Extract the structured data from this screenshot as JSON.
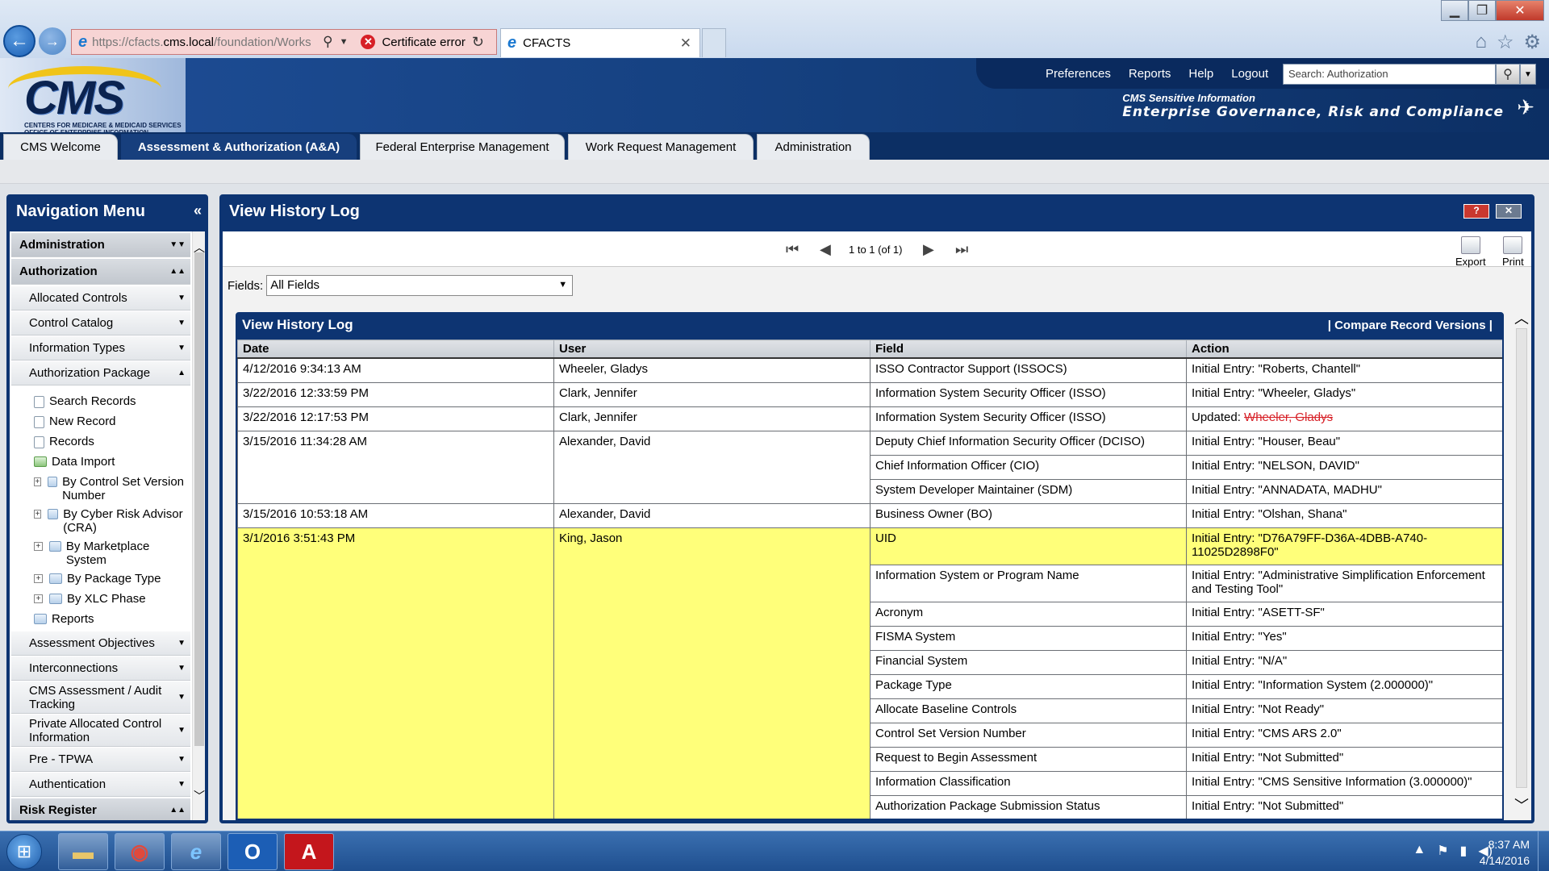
{
  "browser": {
    "url_prefix": "https://cfacts.",
    "url_host": "cms.local",
    "url_path": "/foundation/Works",
    "certificate_error": "Certificate error",
    "tab_title": "CFACTS"
  },
  "header": {
    "logo_text": "CMS",
    "logo_subtext": "CENTERS FOR MEDICARE & MEDICAID SERVICES OFFICE OF ENTERPRISE INFORMATION",
    "links": [
      "Preferences",
      "Reports",
      "Help",
      "Logout"
    ],
    "search_value": "Search: Authorization",
    "tagline_1": "CMS Sensitive Information",
    "tagline_2": "Enterprise Governance, Risk and Compliance"
  },
  "module_tabs": [
    "CMS Welcome",
    "Assessment & Authorization (A&A)",
    "Federal Enterprise Management",
    "Work Request Management",
    "Administration"
  ],
  "nav": {
    "title": "Navigation Menu",
    "administration": "Administration",
    "authorization": "Authorization",
    "allocated_controls": "Allocated Controls",
    "control_catalog": "Control Catalog",
    "information_types": "Information Types",
    "authorization_package": "Authorization Package",
    "search_records": "Search Records",
    "new_record": "New Record",
    "records": "Records",
    "data_import": "Data Import",
    "by_control_set": "By Control Set Version Number",
    "by_cyber_risk": "By Cyber Risk Advisor (CRA)",
    "by_marketplace": "By Marketplace System",
    "by_package_type": "By Package Type",
    "by_xlc_phase": "By XLC Phase",
    "reports": "Reports",
    "assessment_objectives": "Assessment Objectives",
    "interconnections": "Interconnections",
    "cms_assessment": "CMS Assessment / Audit Tracking",
    "private_allocated": "Private Allocated Control Information",
    "pre_tpwa": "Pre - TPWA",
    "authentication": "Authentication",
    "risk_register": "Risk Register"
  },
  "main": {
    "title": "View History Log",
    "pager_text": "1 to 1 (of 1)",
    "export_label": "Export",
    "print_label": "Print",
    "fields_label": "Fields:",
    "fields_value": "All Fields",
    "grid_title": "View History Log",
    "compare_label": "|  Compare Record Versions  |"
  },
  "table": {
    "columns": [
      "Date",
      "User",
      "Field",
      "Action"
    ],
    "rows": [
      {
        "date": "4/12/2016 9:34:13 AM",
        "user": "Wheeler, Gladys",
        "field": "ISSO Contractor Support (ISSOCS)",
        "action": "Initial Entry: \"Roberts, Chantell\""
      },
      {
        "date": "3/22/2016 12:33:59 PM",
        "user": "Clark, Jennifer",
        "field": "Information System Security Officer (ISSO)",
        "action": "Initial Entry: \"Wheeler, Gladys\""
      },
      {
        "date": "3/22/2016 12:17:53 PM",
        "user": "Clark, Jennifer",
        "field": "Information System Security Officer (ISSO)",
        "action_prefix": "Updated: ",
        "action_struck": "Wheeler, Gladys"
      },
      {
        "date": "3/15/2016 11:34:28 AM",
        "user": "Alexander, David",
        "field": "Deputy Chief Information Security Officer (DCISO)",
        "action": "Initial Entry: \"Houser, Beau\""
      },
      {
        "field": "Chief Information Officer (CIO)",
        "action": "Initial Entry: \"NELSON, DAVID\""
      },
      {
        "field": "System Developer Maintainer (SDM)",
        "action": "Initial Entry: \"ANNADATA, MADHU\""
      },
      {
        "date": "3/15/2016 10:53:18 AM",
        "user": "Alexander, David",
        "field": "Business Owner (BO)",
        "action": "Initial Entry: \"Olshan, Shana\""
      },
      {
        "date": "3/1/2016 3:51:43 PM",
        "user": "King, Jason",
        "field": "UID",
        "action": "Initial Entry: \"D76A79FF-D36A-4DBB-A740-11025D2898F0\""
      },
      {
        "field": "Information System or Program Name",
        "action": "Initial Entry: \"Administrative Simplification Enforcement and Testing Tool\""
      },
      {
        "field": "Acronym",
        "action": "Initial Entry: \"ASETT-SF\""
      },
      {
        "field": "FISMA System",
        "action": "Initial Entry: \"Yes\""
      },
      {
        "field": "Financial System",
        "action": "Initial Entry: \"N/A\""
      },
      {
        "field": "Package Type",
        "action": "Initial Entry: \"Information System (2.000000)\""
      },
      {
        "field": "Allocate Baseline Controls",
        "action": "Initial Entry: \"Not Ready\""
      },
      {
        "field": "Control Set Version Number",
        "action": "Initial Entry: \"CMS ARS 2.0\""
      },
      {
        "field": "Request to Begin Assessment",
        "action": "Initial Entry: \"Not Submitted\""
      },
      {
        "field": "Information Classification",
        "action": "Initial Entry: \"CMS Sensitive Information (3.000000)\""
      },
      {
        "field": "Authorization Package Submission Status",
        "action": "Initial Entry: \"Not Submitted\""
      }
    ]
  },
  "taskbar": {
    "time": "8:37 AM",
    "date": "4/14/2016"
  },
  "colors": {
    "header_blue": "#15407f",
    "highlight_yellow": "#ffff7a",
    "strike_red": "#d71f26"
  }
}
